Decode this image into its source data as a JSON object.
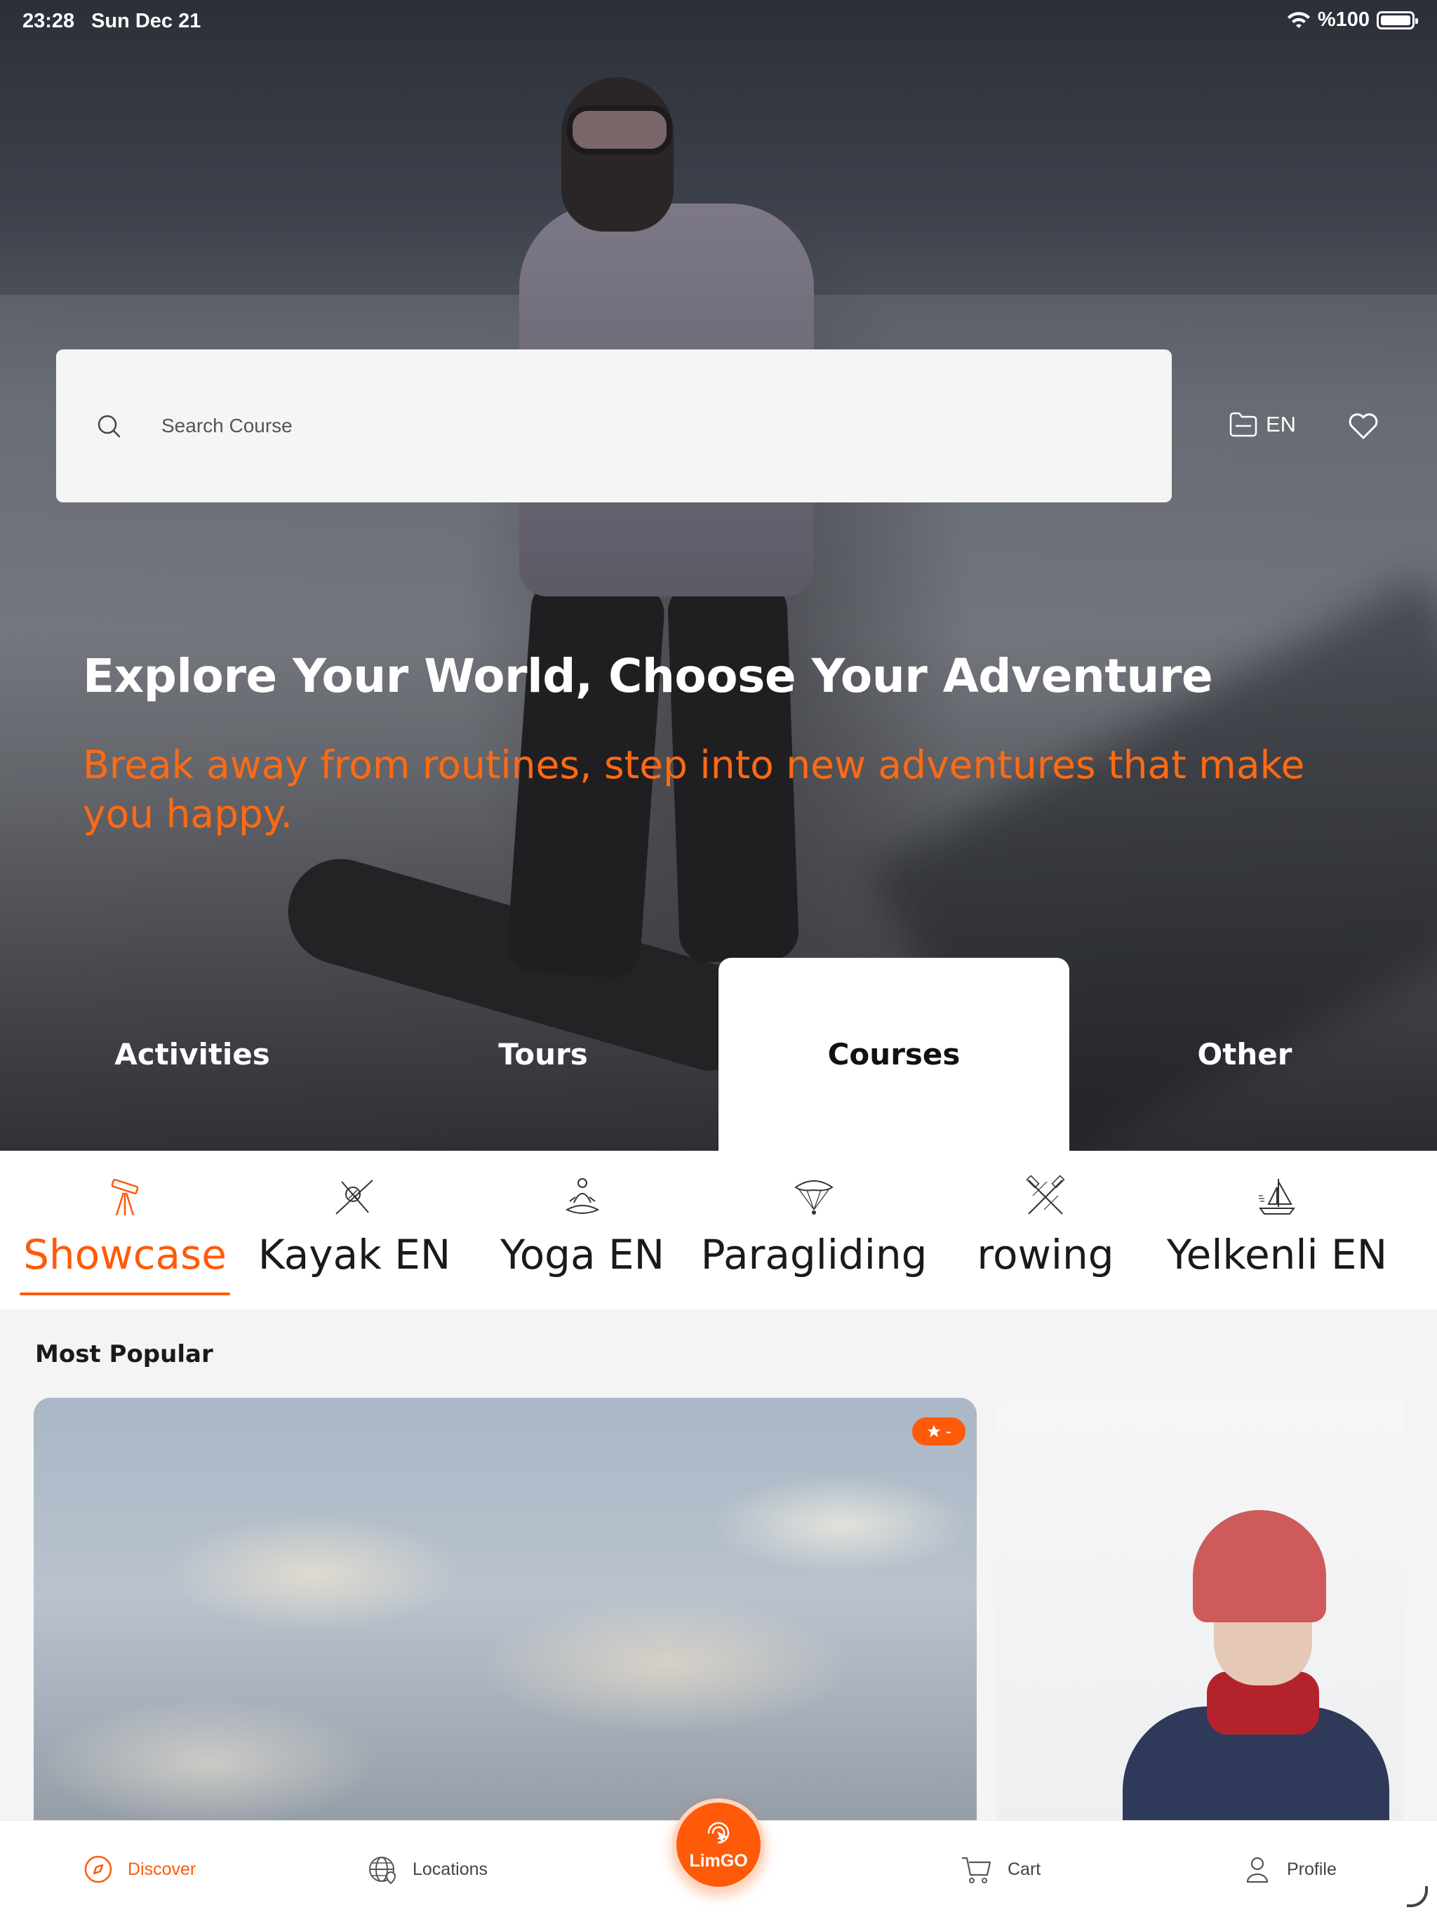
{
  "status_bar": {
    "time": "23:28",
    "date": "Sun Dec 21",
    "battery": "%100"
  },
  "search": {
    "placeholder": "Search Course"
  },
  "header_actions": {
    "language": "EN"
  },
  "hero": {
    "title": "Explore Your World, Choose Your Adventure",
    "subtitle": "Break away from routines, step into new adventures that make you happy."
  },
  "main_tabs": [
    {
      "label": "Activities",
      "active": false
    },
    {
      "label": "Tours",
      "active": false
    },
    {
      "label": "Courses",
      "active": true
    },
    {
      "label": "Other",
      "active": false
    }
  ],
  "categories": [
    {
      "label": "Showcase",
      "icon": "telescope-icon",
      "active": true
    },
    {
      "label": "Kayak EN",
      "icon": "kayak-icon",
      "active": false
    },
    {
      "label": "Yoga EN",
      "icon": "yoga-icon",
      "active": false
    },
    {
      "label": "Paragliding",
      "icon": "paraglider-icon",
      "active": false
    },
    {
      "label": "rowing",
      "icon": "oars-icon",
      "active": false
    },
    {
      "label": "Yelkenli EN",
      "icon": "sailboat-icon",
      "active": false
    }
  ],
  "section": {
    "title": "Most Popular"
  },
  "card": {
    "rating": "-"
  },
  "bottom_nav": {
    "discover": "Discover",
    "locations": "Locations",
    "limgo": "LimGO",
    "cart": "Cart",
    "profile": "Profile"
  },
  "colors": {
    "accent": "#ff5a0a",
    "subtitle": "#ff6a13",
    "tab_active_bg": "#ffffff"
  }
}
